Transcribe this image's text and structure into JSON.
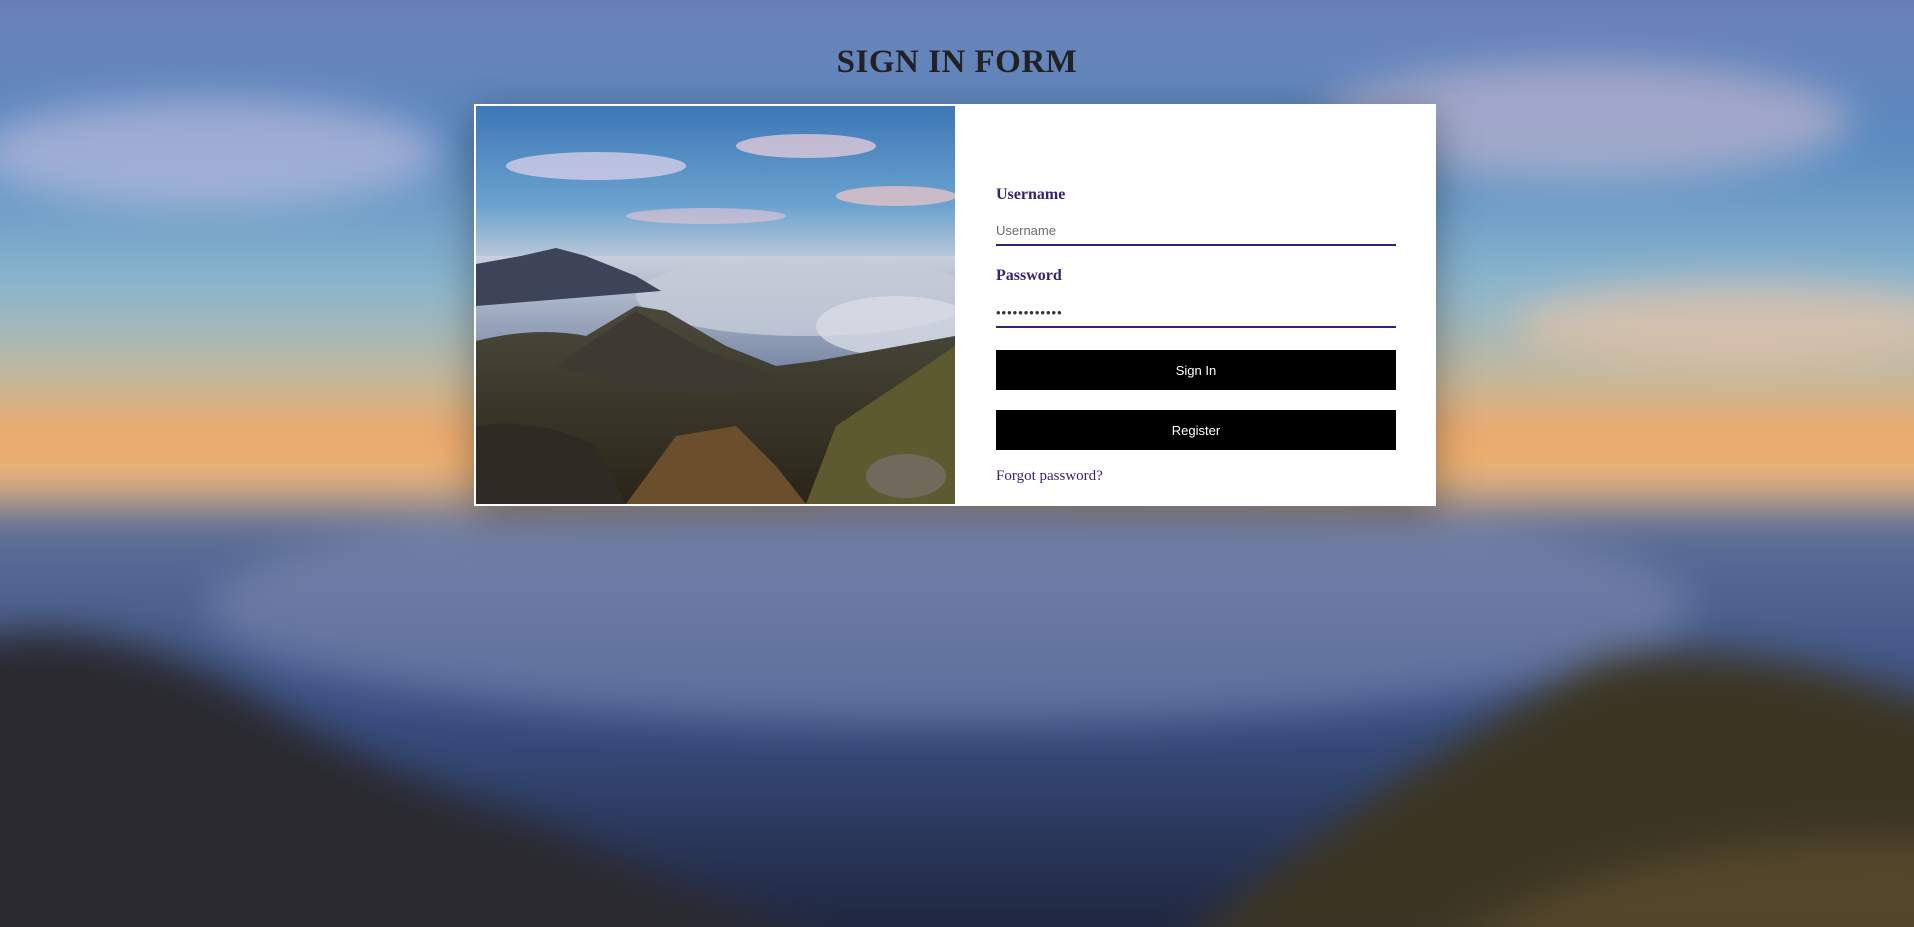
{
  "page": {
    "title": "SIGN IN FORM"
  },
  "form": {
    "username_label": "Username",
    "username_placeholder": "Username",
    "password_label": "Password",
    "password_value": "••••••••••••",
    "signin_label": "Sign In",
    "register_label": "Register",
    "forgot_label": "Forgot password?"
  },
  "colors": {
    "accent": "#3a1f6e",
    "button_bg": "#000000",
    "button_text": "#ffffff",
    "title": "#222222",
    "card_bg": "#ffffff"
  },
  "images": {
    "background": "mountain-sunset-landscape",
    "card_image": "mountain-sunset-landscape"
  }
}
